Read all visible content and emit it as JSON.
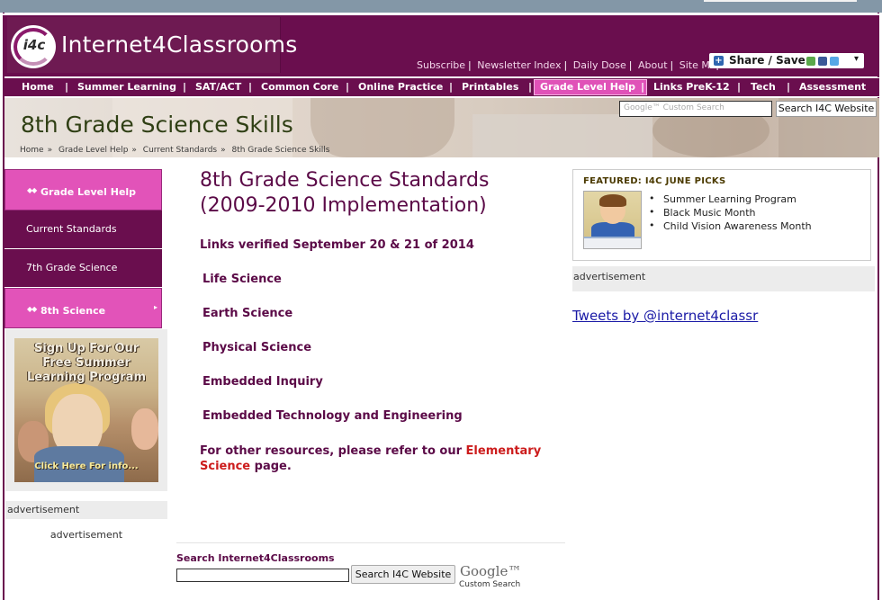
{
  "site": {
    "logo_badge": "i4c",
    "logo_title": "Internet4Classrooms"
  },
  "top_links": [
    "Subscribe",
    "Newsletter Index",
    "Daily Dose",
    "About",
    "Site Map"
  ],
  "share": {
    "label": "Share / Save"
  },
  "nav": {
    "items": [
      "Home",
      "Summer Learning",
      "SAT/ACT",
      "Common Core",
      "Online Practice",
      "Printables",
      "Grade Level Help",
      "Links PreK-12",
      "Tech",
      "Assessment"
    ],
    "active": "Grade Level Help"
  },
  "banner": {
    "title": "8th Grade Science Skills",
    "breadcrumbs": [
      "Home",
      "Grade Level Help",
      "Current Standards",
      "8th Grade Science Skills"
    ],
    "search_placeholder": "Google™ Custom Search",
    "search_button": "Search I4C Website"
  },
  "sidebar": {
    "items": [
      {
        "label": "Grade Level Help",
        "style": "pink"
      },
      {
        "label": "Current Standards",
        "style": "dark"
      },
      {
        "label": "7th Grade Science",
        "style": "dark"
      },
      {
        "label": "8th Science",
        "style": "pink"
      }
    ],
    "promo": {
      "lines": [
        "Sign Up For Our",
        "Free Summer",
        "Learning Program"
      ],
      "cta": "Click Here For info..."
    },
    "ad_label": "advertisement",
    "ad_text": "advertisement"
  },
  "main": {
    "title_line1": "8th Grade Science Standards",
    "title_line2": "(2009-2010 Implementation)",
    "verified": "Links verified September 20 & 21 of 2014",
    "links": [
      "Life Science",
      "Earth Science",
      "Physical Science",
      "Embedded Inquiry",
      "Embedded Technology and Engineering"
    ],
    "other_prefix": "For other resources, please refer to our",
    "other_link": "Elementary Science",
    "other_suffix": "page.",
    "bottom_search_label": "Search Internet4Classrooms",
    "bottom_search_button": "Search I4C Website",
    "google_logo": "Google™",
    "google_sub": "Custom Search"
  },
  "right": {
    "featured_title": "FEATURED: I4C JUNE PICKS",
    "featured_items": [
      "Summer Learning Program",
      "Black Music Month",
      "Child Vision Awareness Month"
    ],
    "ad_label": "advertisement",
    "tweets": "Tweets by @internet4classr"
  },
  "colors": {
    "brand": "#6a0e4e",
    "accent_pink": "#e253b9",
    "link_red": "#cc1c1c"
  }
}
